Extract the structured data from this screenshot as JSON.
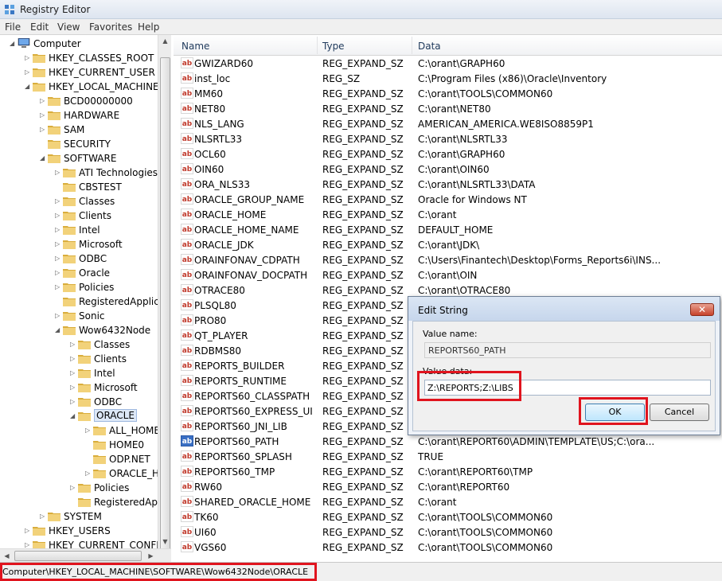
{
  "window": {
    "title": "Registry Editor"
  },
  "menu": [
    "File",
    "Edit",
    "View",
    "Favorites",
    "Help"
  ],
  "tree": [
    {
      "label": "Computer",
      "indent": 0,
      "expanded": true,
      "icon": "computer"
    },
    {
      "label": "HKEY_CLASSES_ROOT",
      "indent": 1,
      "expanded": false
    },
    {
      "label": "HKEY_CURRENT_USER",
      "indent": 1,
      "expanded": false
    },
    {
      "label": "HKEY_LOCAL_MACHINE",
      "indent": 1,
      "expanded": true
    },
    {
      "label": "BCD00000000",
      "indent": 2,
      "expanded": false
    },
    {
      "label": "HARDWARE",
      "indent": 2,
      "expanded": false
    },
    {
      "label": "SAM",
      "indent": 2,
      "expanded": false
    },
    {
      "label": "SECURITY",
      "indent": 2,
      "expanded": null
    },
    {
      "label": "SOFTWARE",
      "indent": 2,
      "expanded": true
    },
    {
      "label": "ATI Technologies",
      "indent": 3,
      "expanded": false
    },
    {
      "label": "CBSTEST",
      "indent": 3,
      "expanded": null
    },
    {
      "label": "Classes",
      "indent": 3,
      "expanded": false
    },
    {
      "label": "Clients",
      "indent": 3,
      "expanded": false
    },
    {
      "label": "Intel",
      "indent": 3,
      "expanded": false
    },
    {
      "label": "Microsoft",
      "indent": 3,
      "expanded": false
    },
    {
      "label": "ODBC",
      "indent": 3,
      "expanded": false
    },
    {
      "label": "Oracle",
      "indent": 3,
      "expanded": false
    },
    {
      "label": "Policies",
      "indent": 3,
      "expanded": false
    },
    {
      "label": "RegisteredApplica",
      "indent": 3,
      "expanded": null
    },
    {
      "label": "Sonic",
      "indent": 3,
      "expanded": false
    },
    {
      "label": "Wow6432Node",
      "indent": 3,
      "expanded": true
    },
    {
      "label": "Classes",
      "indent": 4,
      "expanded": false
    },
    {
      "label": "Clients",
      "indent": 4,
      "expanded": false
    },
    {
      "label": "Intel",
      "indent": 4,
      "expanded": false
    },
    {
      "label": "Microsoft",
      "indent": 4,
      "expanded": false
    },
    {
      "label": "ODBC",
      "indent": 4,
      "expanded": false
    },
    {
      "label": "ORACLE",
      "indent": 4,
      "expanded": true,
      "selected": true
    },
    {
      "label": "ALL_HOME",
      "indent": 5,
      "expanded": false
    },
    {
      "label": "HOME0",
      "indent": 5,
      "expanded": null
    },
    {
      "label": "ODP.NET",
      "indent": 5,
      "expanded": null
    },
    {
      "label": "ORACLE_H",
      "indent": 5,
      "expanded": false
    },
    {
      "label": "Policies",
      "indent": 4,
      "expanded": false
    },
    {
      "label": "RegisteredApp",
      "indent": 4,
      "expanded": null
    },
    {
      "label": "SYSTEM",
      "indent": 2,
      "expanded": false
    },
    {
      "label": "HKEY_USERS",
      "indent": 1,
      "expanded": false
    },
    {
      "label": "HKEY_CURRENT_CONFIG",
      "indent": 1,
      "expanded": false
    }
  ],
  "columns": {
    "name": "Name",
    "type": "Type",
    "data": "Data"
  },
  "values": [
    {
      "name": "GWIZARD60",
      "type": "REG_EXPAND_SZ",
      "data": "C:\\orant\\GRAPH60"
    },
    {
      "name": "inst_loc",
      "type": "REG_SZ",
      "data": "C:\\Program Files (x86)\\Oracle\\Inventory"
    },
    {
      "name": "MM60",
      "type": "REG_EXPAND_SZ",
      "data": "C:\\orant\\TOOLS\\COMMON60"
    },
    {
      "name": "NET80",
      "type": "REG_EXPAND_SZ",
      "data": "C:\\orant\\NET80"
    },
    {
      "name": "NLS_LANG",
      "type": "REG_EXPAND_SZ",
      "data": "AMERICAN_AMERICA.WE8ISO8859P1"
    },
    {
      "name": "NLSRTL33",
      "type": "REG_EXPAND_SZ",
      "data": "C:\\orant\\NLSRTL33"
    },
    {
      "name": "OCL60",
      "type": "REG_EXPAND_SZ",
      "data": "C:\\orant\\GRAPH60"
    },
    {
      "name": "OIN60",
      "type": "REG_EXPAND_SZ",
      "data": "C:\\orant\\OIN60"
    },
    {
      "name": "ORA_NLS33",
      "type": "REG_EXPAND_SZ",
      "data": "C:\\orant\\NLSRTL33\\DATA"
    },
    {
      "name": "ORACLE_GROUP_NAME",
      "type": "REG_EXPAND_SZ",
      "data": "Oracle for Windows NT"
    },
    {
      "name": "ORACLE_HOME",
      "type": "REG_EXPAND_SZ",
      "data": "C:\\orant"
    },
    {
      "name": "ORACLE_HOME_NAME",
      "type": "REG_EXPAND_SZ",
      "data": "DEFAULT_HOME"
    },
    {
      "name": "ORACLE_JDK",
      "type": "REG_EXPAND_SZ",
      "data": "C:\\orant\\JDK\\"
    },
    {
      "name": "ORAINFONAV_CDPATH",
      "type": "REG_EXPAND_SZ",
      "data": "C:\\Users\\Finantech\\Desktop\\Forms_Reports6i\\INS..."
    },
    {
      "name": "ORAINFONAV_DOCPATH",
      "type": "REG_EXPAND_SZ",
      "data": "C:\\orant\\OIN"
    },
    {
      "name": "OTRACE80",
      "type": "REG_EXPAND_SZ",
      "data": "C:\\orant\\OTRACE80"
    },
    {
      "name": "PLSQL80",
      "type": "REG_EXPAND_SZ",
      "data": ""
    },
    {
      "name": "PRO80",
      "type": "REG_EXPAND_SZ",
      "data": ""
    },
    {
      "name": "QT_PLAYER",
      "type": "REG_EXPAND_SZ",
      "data": ""
    },
    {
      "name": "RDBMS80",
      "type": "REG_EXPAND_SZ",
      "data": ""
    },
    {
      "name": "REPORTS_BUILDER",
      "type": "REG_EXPAND_SZ",
      "data": ""
    },
    {
      "name": "REPORTS_RUNTIME",
      "type": "REG_EXPAND_SZ",
      "data": ""
    },
    {
      "name": "REPORTS60_CLASSPATH",
      "type": "REG_EXPAND_SZ",
      "data": ""
    },
    {
      "name": "REPORTS60_EXPRESS_UI",
      "type": "REG_EXPAND_SZ",
      "data": ""
    },
    {
      "name": "REPORTS60_JNI_LIB",
      "type": "REG_EXPAND_SZ",
      "data": ""
    },
    {
      "name": "REPORTS60_PATH",
      "type": "REG_EXPAND_SZ",
      "data": "C:\\orant\\REPORT60\\ADMIN\\TEMPLATE\\US;C:\\ora...",
      "selected": true
    },
    {
      "name": "REPORTS60_SPLASH",
      "type": "REG_EXPAND_SZ",
      "data": "TRUE"
    },
    {
      "name": "REPORTS60_TMP",
      "type": "REG_EXPAND_SZ",
      "data": "C:\\orant\\REPORT60\\TMP"
    },
    {
      "name": "RW60",
      "type": "REG_EXPAND_SZ",
      "data": "C:\\orant\\REPORT60"
    },
    {
      "name": "SHARED_ORACLE_HOME",
      "type": "REG_EXPAND_SZ",
      "data": "C:\\orant"
    },
    {
      "name": "TK60",
      "type": "REG_EXPAND_SZ",
      "data": "C:\\orant\\TOOLS\\COMMON60"
    },
    {
      "name": "UI60",
      "type": "REG_EXPAND_SZ",
      "data": "C:\\orant\\TOOLS\\COMMON60"
    },
    {
      "name": "VGS60",
      "type": "REG_EXPAND_SZ",
      "data": "C:\\orant\\TOOLS\\COMMON60"
    }
  ],
  "status": {
    "path": "Computer\\HKEY_LOCAL_MACHINE\\SOFTWARE\\Wow6432Node\\ORACLE"
  },
  "dialog": {
    "title": "Edit String",
    "close_label": "✕",
    "value_name_label": "Value name:",
    "value_name": "REPORTS60_PATH",
    "value_data_label": "Value data:",
    "value_data": "Z:\\REPORTS;Z:\\LIBS",
    "ok_label": "OK",
    "cancel_label": "Cancel"
  },
  "colors": {
    "highlight": "#e0141e",
    "folder": "#e8c25a",
    "selected": "#3a6fc4"
  }
}
